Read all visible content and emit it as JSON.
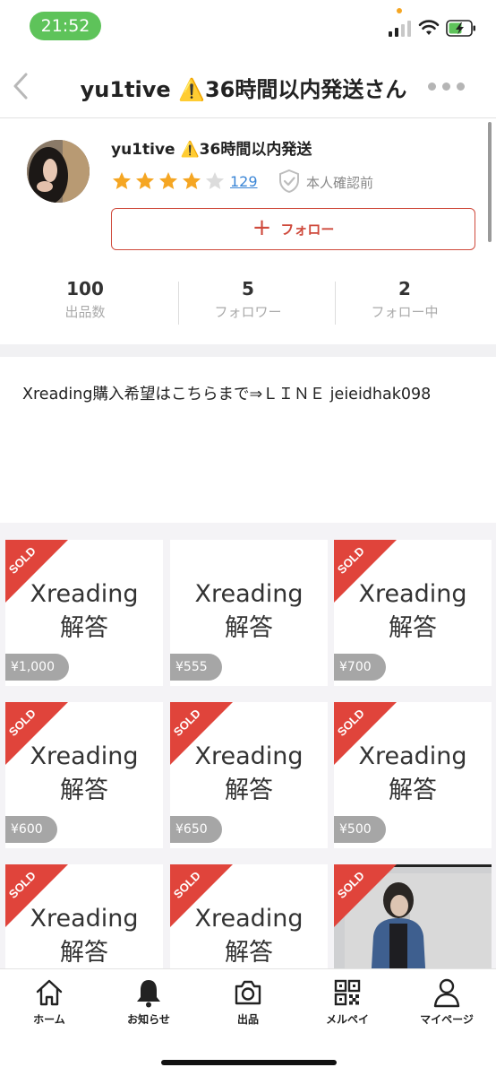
{
  "status_bar": {
    "time": "21:52"
  },
  "nav": {
    "title": "yu1tive ⚠️36時間以内発送さん"
  },
  "profile": {
    "name": "yu1tive ⚠️36時間以内発送",
    "rating": 4,
    "rating_max": 5,
    "rating_count": "129",
    "verify_label": "本人確認前",
    "follow_label": "フォロー",
    "stats": [
      {
        "value": "100",
        "label": "出品数"
      },
      {
        "value": "5",
        "label": "フォロワー"
      },
      {
        "value": "2",
        "label": "フォロー中"
      }
    ]
  },
  "bio": "Xreading購入希望はこちらまで⇒ＬＩＮＥ jeieidhak098",
  "items": [
    {
      "title_line1": "Xreading",
      "title_line2": "解答",
      "price": "¥1,000",
      "sold": true,
      "sold_label": "SOLD"
    },
    {
      "title_line1": "Xreading",
      "title_line2": "解答",
      "price": "¥555",
      "sold": false,
      "sold_label": ""
    },
    {
      "title_line1": "Xreading",
      "title_line2": "解答",
      "price": "¥700",
      "sold": true,
      "sold_label": "SOLD"
    },
    {
      "title_line1": "Xreading",
      "title_line2": "解答",
      "price": "¥600",
      "sold": true,
      "sold_label": "SOLD"
    },
    {
      "title_line1": "Xreading",
      "title_line2": "解答",
      "price": "¥650",
      "sold": true,
      "sold_label": "SOLD"
    },
    {
      "title_line1": "Xreading",
      "title_line2": "解答",
      "price": "¥500",
      "sold": true,
      "sold_label": "SOLD"
    },
    {
      "title_line1": "Xreading",
      "title_line2": "解答",
      "price": "",
      "sold": true,
      "sold_label": "SOLD"
    },
    {
      "title_line1": "Xreading",
      "title_line2": "解答",
      "price": "",
      "sold": true,
      "sold_label": "SOLD"
    },
    {
      "title_line1": "",
      "title_line2": "",
      "price": "",
      "sold": true,
      "sold_label": "SOLD",
      "photo": true
    }
  ],
  "tabs": [
    {
      "label": "ホーム",
      "icon": "home-icon"
    },
    {
      "label": "お知らせ",
      "icon": "bell-icon"
    },
    {
      "label": "出品",
      "icon": "camera-icon"
    },
    {
      "label": "メルペイ",
      "icon": "qr-code-icon"
    },
    {
      "label": "マイページ",
      "icon": "person-icon"
    }
  ],
  "colors": {
    "accent_red": "#cf4a3c",
    "sold_red": "#e0443b",
    "star_gold": "#f5a623",
    "link_blue": "#3b86d6",
    "status_green": "#5ec35a"
  }
}
